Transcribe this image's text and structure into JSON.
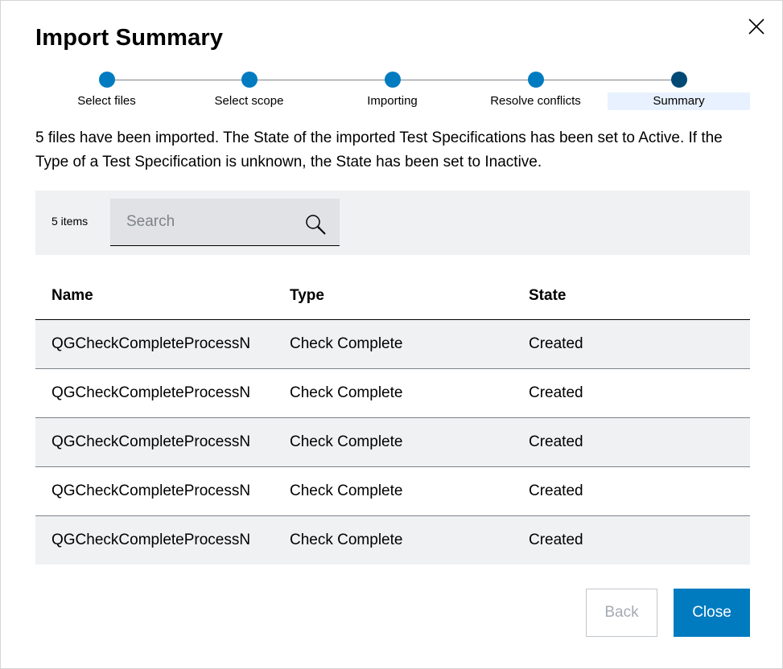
{
  "dialog": {
    "title": "Import Summary",
    "description": "5 files have been imported. The State of the imported Test Specifications has been set to Active. If the Type of a Test Specification is unknown, the State has been set to Inactive."
  },
  "stepper": {
    "steps": [
      {
        "label": "Select files"
      },
      {
        "label": "Select scope"
      },
      {
        "label": "Importing"
      },
      {
        "label": "Resolve conflicts"
      },
      {
        "label": "Summary"
      }
    ],
    "active_step": "Summary"
  },
  "toolbar": {
    "item_count": "5 items",
    "search": {
      "placeholder": "Search",
      "value": ""
    }
  },
  "table": {
    "columns": [
      "Name",
      "Type",
      "State"
    ],
    "rows": [
      {
        "name": "QGCheckCompleteProcessN",
        "type": "Check Complete",
        "state": "Created"
      },
      {
        "name": "QGCheckCompleteProcessN",
        "type": "Check Complete",
        "state": "Created"
      },
      {
        "name": "QGCheckCompleteProcessN",
        "type": "Check Complete",
        "state": "Created"
      },
      {
        "name": "QGCheckCompleteProcessN",
        "type": "Check Complete",
        "state": "Created"
      },
      {
        "name": "QGCheckCompleteProcessN",
        "type": "Check Complete",
        "state": "Created"
      }
    ]
  },
  "footer": {
    "back_label": "Back",
    "close_label": "Close",
    "back_disabled": true
  },
  "icons": {
    "close": "close-icon",
    "search": "search-icon"
  },
  "colors": {
    "accent": "#007bc0",
    "active_step": "#004975",
    "step_highlight": "#e8f1ff",
    "toolbar_bg": "#eff1f2"
  }
}
